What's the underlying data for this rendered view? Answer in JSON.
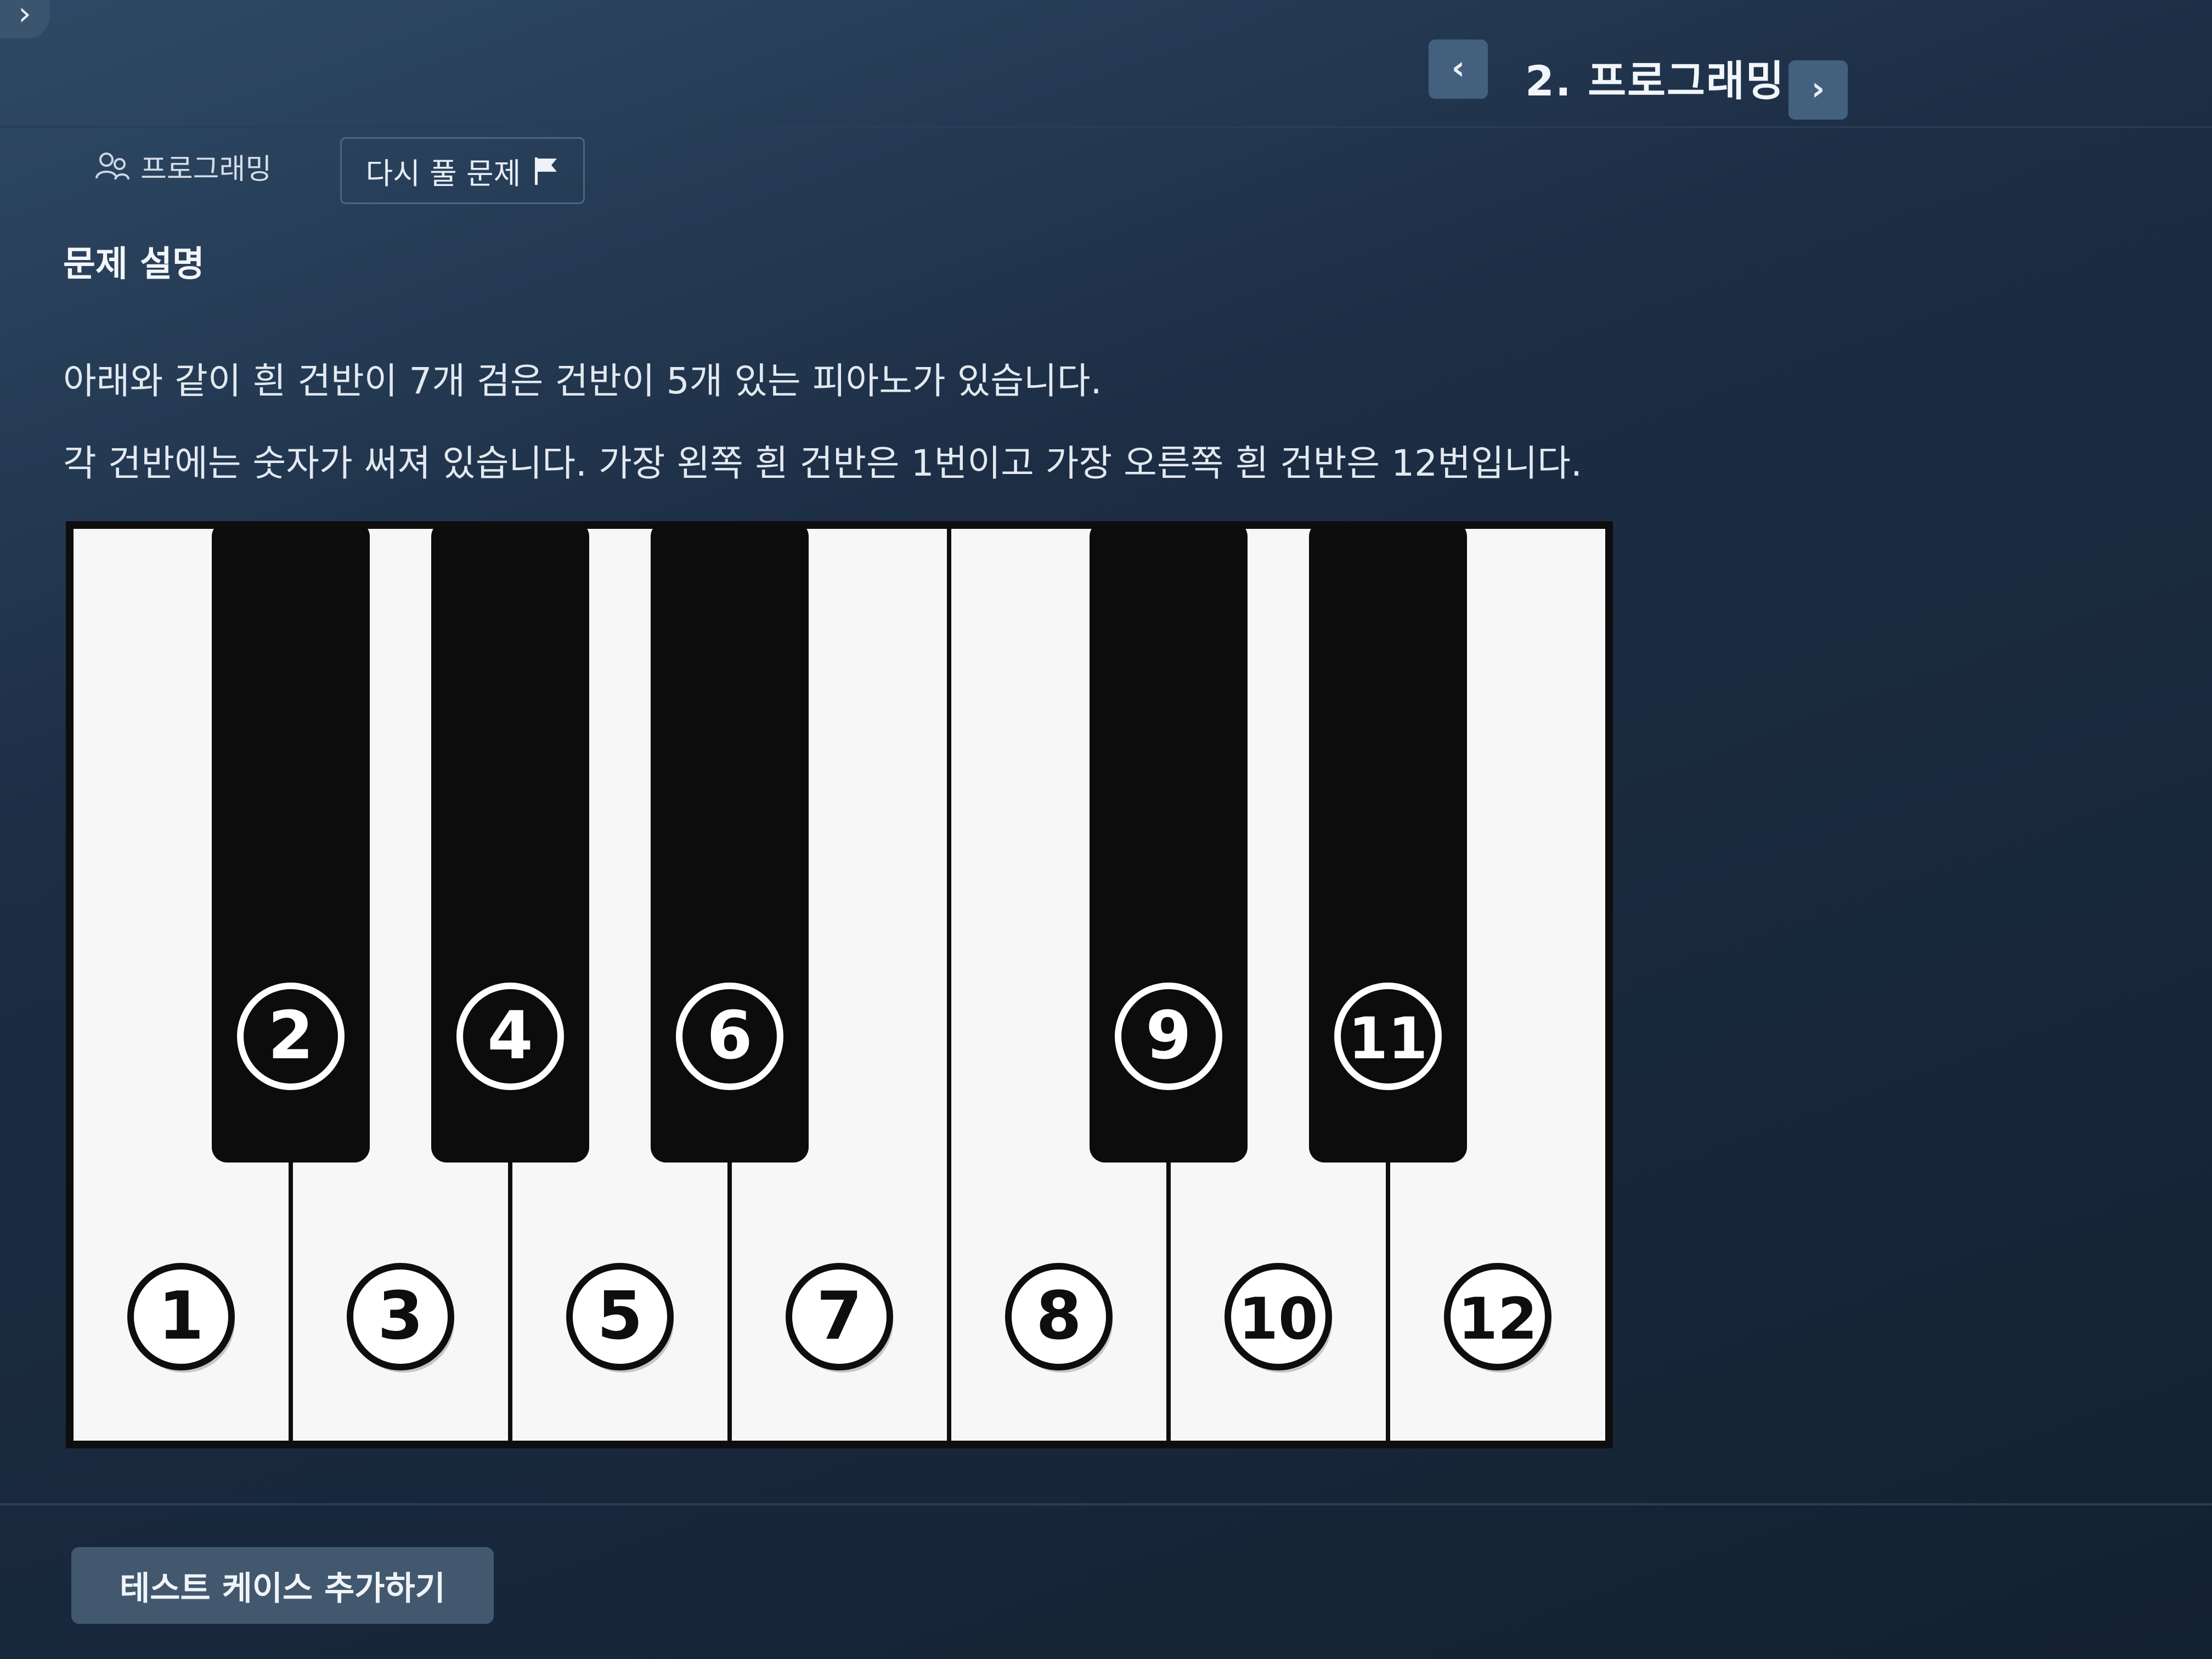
{
  "header": {
    "prev_icon": "chevron-left-icon",
    "next_icon": "chevron-right-icon",
    "prev_glyph": "‹",
    "next_glyph": "›",
    "title": "2. 프로그래밍"
  },
  "corner": {
    "glyph": "›"
  },
  "tags": {
    "category_label": "프로그래밍",
    "category_icon": "people-icon",
    "retry_label": "다시 풀 문제",
    "retry_icon": "flag-icon"
  },
  "problem": {
    "section_title": "문제 설명",
    "lines": [
      "아래와 같이 흰 건반이 7개 검은 건반이 5개 있는 피아노가 있습니다.",
      "각 건반에는 숫자가 써져 있습니다. 가장 왼쪽 흰 건반은 1번이고 가장 오른쪽 흰 건반은 12번입니다."
    ]
  },
  "piano": {
    "white_keys": [
      "1",
      "3",
      "5",
      "7",
      "8",
      "10",
      "12"
    ],
    "black_keys": [
      {
        "label": "2",
        "after_white": 1
      },
      {
        "label": "4",
        "after_white": 2
      },
      {
        "label": "6",
        "after_white": 3
      },
      {
        "label": "9",
        "after_white": 5
      },
      {
        "label": "11",
        "after_white": 6
      }
    ]
  },
  "footer": {
    "add_test_label": "테스트 케이스 추가하기"
  }
}
